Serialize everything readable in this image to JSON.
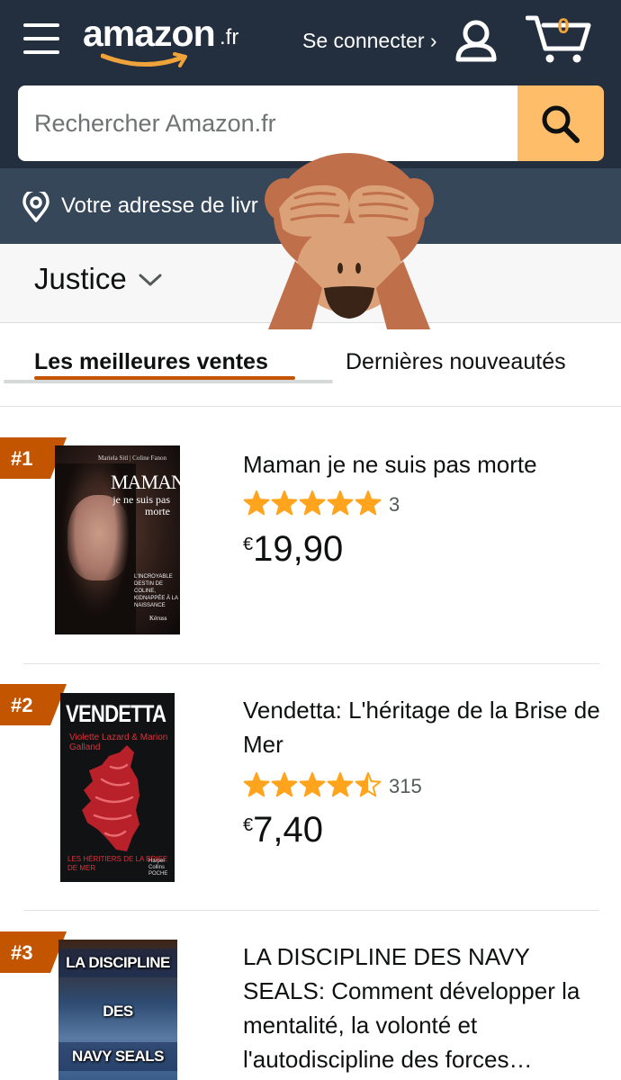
{
  "header": {
    "logo_word": "amazon",
    "logo_tld": ".fr",
    "signin_label": "Se connecter ›",
    "cart_count": "0"
  },
  "search": {
    "placeholder": "Rechercher Amazon.fr"
  },
  "address": {
    "label": "Votre adresse de livr"
  },
  "category": {
    "label": "Justice"
  },
  "tabs": [
    {
      "label": "Les meilleures ventes",
      "active": true
    },
    {
      "label": "Dernières nouveautés",
      "active": false
    }
  ],
  "products": [
    {
      "rank": "#1",
      "title": "Maman je ne suis pas morte",
      "rating": 5,
      "review_count": "3",
      "currency": "€",
      "price": "19,90",
      "cover": {
        "authors": "Mariela Sitl | Coline Fanon",
        "title_main": "MAMAN,",
        "title_sub": "je ne suis pas morte",
        "blurb": "L'INCROYABLE DESTIN DE COLINE, KIDNAPPÉE À LA NAISSANCE",
        "publisher": "Kéruss"
      }
    },
    {
      "rank": "#2",
      "title": "Vendetta: L'héritage de la Brise de Mer",
      "rating": 4.5,
      "review_count": "315",
      "currency": "€",
      "price": "7,40",
      "cover": {
        "title": "VENDETTA",
        "authors": "Violette Lazard & Marion Galland",
        "subtitle": "LES HÉRITIERS DE LA BRISE DE MER",
        "publisher": "Harper Collins POCHE"
      }
    },
    {
      "rank": "#3",
      "title": "LA DISCIPLINE DES NAVY SEALS: Comment développer la mentalité, la volonté et l'autodiscipline des forces…",
      "cover": {
        "line1": "LA DISCIPLINE",
        "line2": "DES",
        "line3": "NAVY SEALS"
      }
    }
  ],
  "colors": {
    "header_bg": "#232f3e",
    "address_bg": "#37475a",
    "search_button": "#febd69",
    "rank_badge": "#c45500",
    "star": "#ffa41c",
    "cart_count": "#f0a33a"
  },
  "icons": {
    "menu": "hamburger-icon",
    "account": "user-icon",
    "cart": "cart-icon",
    "search": "search-icon",
    "location": "location-pin-icon",
    "dropdown": "chevron-down-icon",
    "overlay": "see-no-evil-monkey-emoji"
  }
}
